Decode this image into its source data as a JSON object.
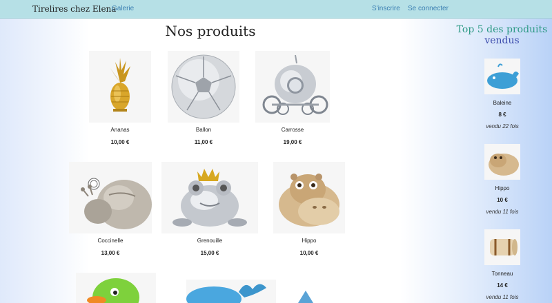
{
  "navbar": {
    "brand": "Tirelires chez Elena",
    "gallery": "Galerie",
    "signup": "S'inscrire",
    "login": "Se connecter"
  },
  "main": {
    "title": "Nos produits",
    "products": [
      {
        "name": "Ananas",
        "price": "10,00 €"
      },
      {
        "name": "Ballon",
        "price": "11,00 €"
      },
      {
        "name": "Carrosse",
        "price": "19,00 €"
      },
      {
        "name": "Coccinelle",
        "price": "13,00 €"
      },
      {
        "name": "Grenouille",
        "price": "15,00 €"
      },
      {
        "name": "Hippo",
        "price": "10,00 €"
      }
    ]
  },
  "sidebar": {
    "title_part1": "Top 5 des produits",
    "title_part2": "vendus",
    "items": [
      {
        "name": "Baleine",
        "price": "8 €",
        "sold": "vendu 22 fois"
      },
      {
        "name": "Hippo",
        "price": "10 €",
        "sold": "vendu 11 fois"
      },
      {
        "name": "Tonneau",
        "price": "14 €",
        "sold": "vendu 11 fois"
      }
    ]
  },
  "colors": {
    "navbar": "#b6e0e6",
    "link": "#3b7fb2",
    "top_title_1": "#2e9a86",
    "top_title_2": "#3f4fae"
  }
}
